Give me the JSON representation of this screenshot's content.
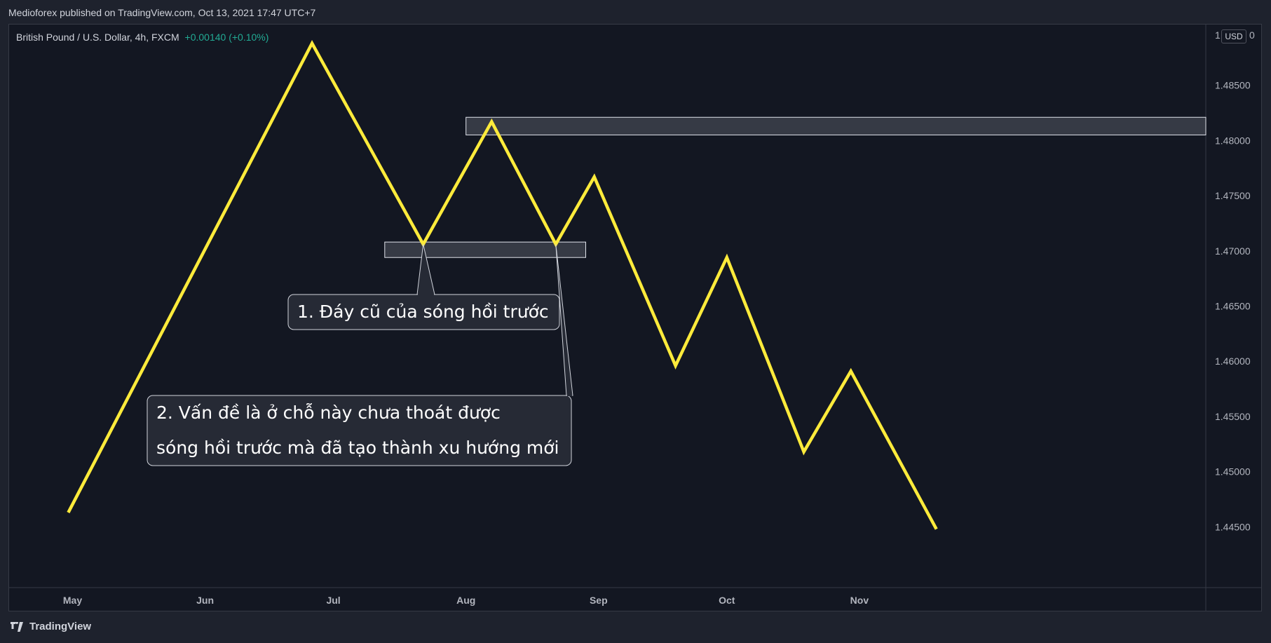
{
  "header": {
    "published_text": "Medioforex published on TradingView.com, Oct 13, 2021 17:47 UTC+7"
  },
  "symbol": {
    "name": "British Pound / U.S. Dollar, 4h, FXCM",
    "change": "+0.00140 (+0.10%)"
  },
  "currency_badge": "USD",
  "price_scale_top_label": "1",
  "price_scale_top_label_right": "0",
  "footer": {
    "brand": "TradingView"
  },
  "colors": {
    "background": "#131722",
    "line": "#ffeb3b",
    "change_positive": "#22ab94",
    "zone_fill": "#3a3e4a",
    "callout_fill": "#262a35"
  },
  "chart_data": {
    "type": "line",
    "title": "",
    "ylim": [
      1.4395,
      1.4905
    ],
    "y_ticks": [
      1.445,
      1.45,
      1.455,
      1.46,
      1.465,
      1.47,
      1.475,
      1.48,
      1.485
    ],
    "y_tick_labels": [
      "1.44500",
      "1.45000",
      "1.45500",
      "1.46000",
      "1.46500",
      "1.47000",
      "1.47500",
      "1.48000",
      "1.48500"
    ],
    "xlim": [
      "2021-04-16",
      "2022-01-21"
    ],
    "x_ticks": [
      "2021-05-01",
      "2021-06-01",
      "2021-07-01",
      "2021-08-01",
      "2021-09-01",
      "2021-10-01",
      "2021-11-01"
    ],
    "x_tick_labels": [
      "May",
      "Jun",
      "Jul",
      "Aug",
      "Sep",
      "Oct",
      "Nov"
    ],
    "series": [
      {
        "x": [
          "2021-04-30",
          "2021-06-26",
          "2021-07-22",
          "2021-08-07",
          "2021-08-22",
          "2021-08-31",
          "2021-09-19",
          "2021-10-01",
          "2021-10-19",
          "2021-10-30",
          "2021-11-19"
        ],
        "y": [
          1.4463,
          1.4888,
          1.4706,
          1.4817,
          1.4706,
          1.4767,
          1.4596,
          1.4694,
          1.4518,
          1.4591,
          1.4448
        ],
        "color": "#ffeb3b"
      }
    ],
    "zones": [
      {
        "x_start": "2021-08-01",
        "x_end": "2022-01-21",
        "y_low": 1.4805,
        "y_high": 1.4821
      },
      {
        "x_start": "2021-07-13",
        "x_end": "2021-08-29",
        "y_low": 1.4694,
        "y_high": 1.4708
      }
    ],
    "annotations": [
      {
        "lines": [
          "1. Đáy cũ của sóng hồi trước"
        ],
        "points_to": [
          "2021-07-22",
          1.4706
        ]
      },
      {
        "lines": [
          "2. Vấn đề là ở chỗ này chưa thoát được",
          "sóng hồi trước mà đã tạo thành xu hướng mới"
        ],
        "points_to": [
          "2021-08-22",
          1.4706
        ]
      }
    ]
  }
}
